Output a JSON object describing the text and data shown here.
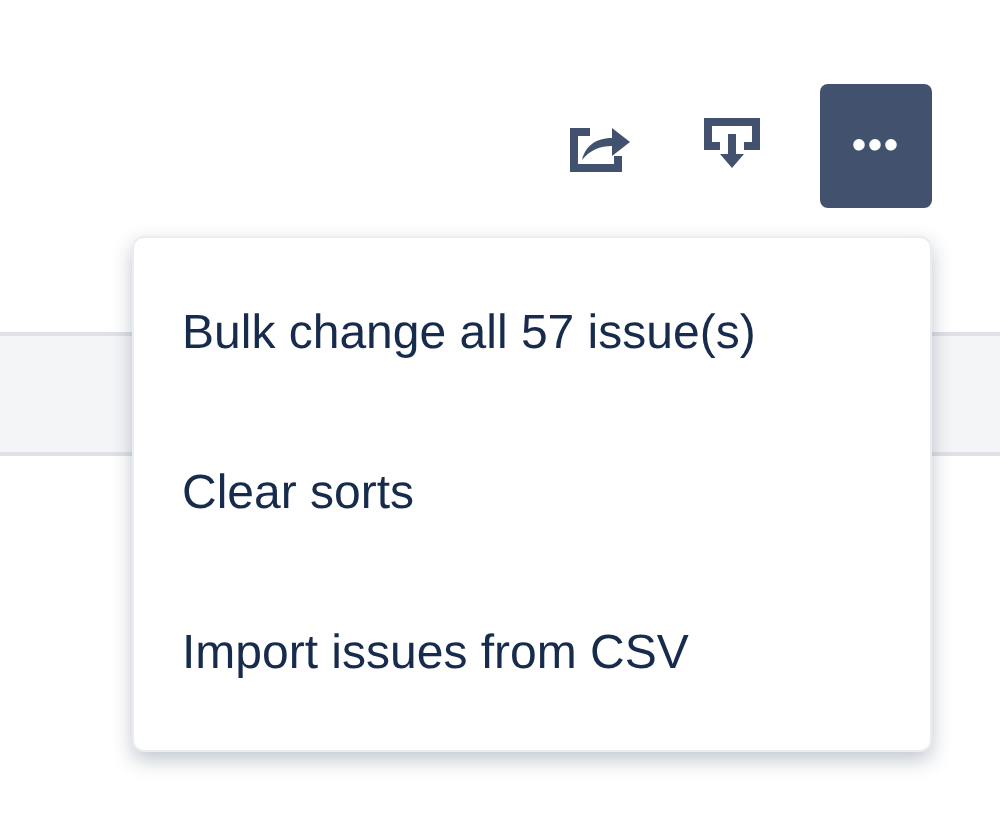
{
  "toolbar": {
    "more_button": {
      "label": "•••",
      "expanded": true
    }
  },
  "menu": {
    "items": [
      {
        "label": "Bulk change all 57 issue(s)"
      },
      {
        "label": "Clear sorts"
      },
      {
        "label": "Import issues from CSV"
      }
    ]
  }
}
